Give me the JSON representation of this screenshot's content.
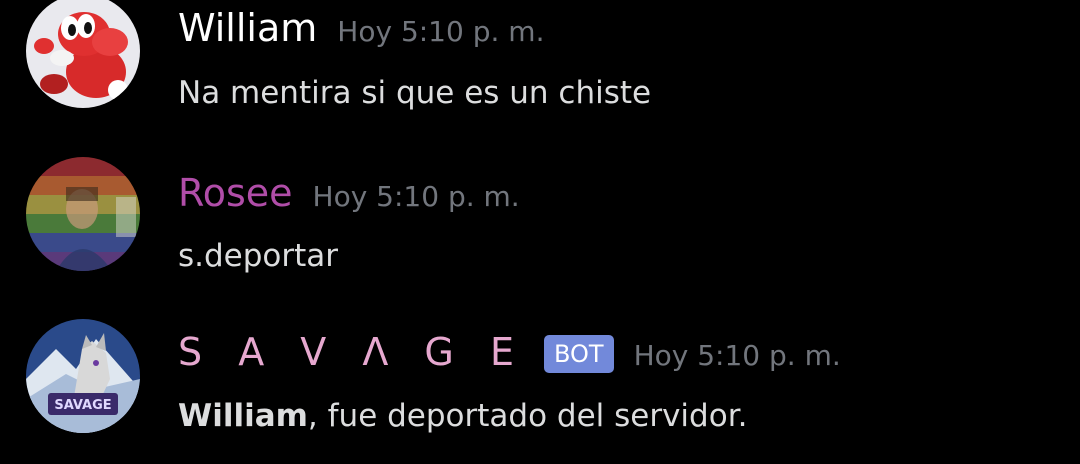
{
  "messages": [
    {
      "author": "William",
      "author_color": "#ffffff",
      "timestamp": "Hoy 5:10 p. m.",
      "text": "Na mentira si que es un chiste",
      "avatar": "yoshi-avatar"
    },
    {
      "author": "Rosee",
      "author_color": "#b04da8",
      "timestamp": "Hoy 5:10 p. m.",
      "text": "s.deportar",
      "avatar": "rainbow-flag-avatar"
    },
    {
      "author": "S A V Λ G E",
      "author_color": "#e6a8cf",
      "bot_tag": "BOT",
      "bot_tag_color": "#7289da",
      "timestamp": "Hoy 5:10 p. m.",
      "mention": "William",
      "text": ", fue deportado del servidor.",
      "avatar": "wolf-savage-avatar",
      "avatar_text": "SAVAGE"
    }
  ]
}
